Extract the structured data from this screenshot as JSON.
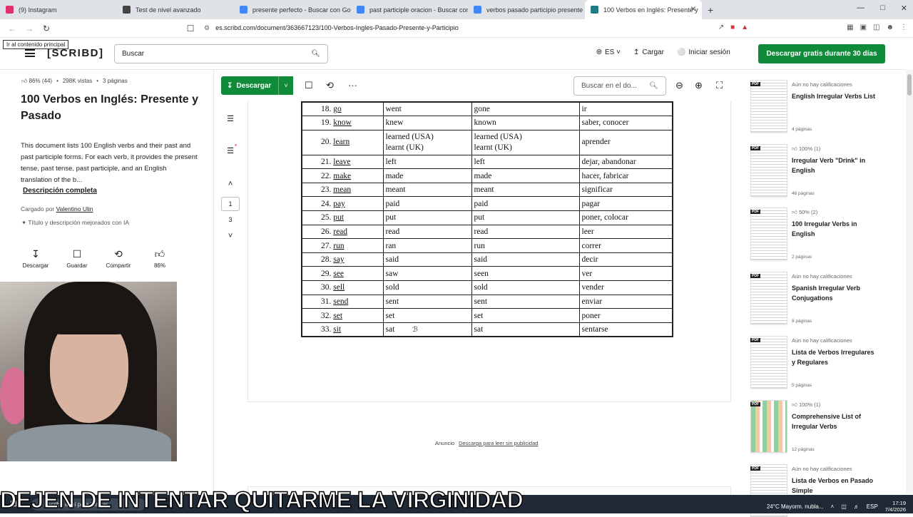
{
  "browser": {
    "tabs": [
      {
        "label": "(9) Instagram",
        "color": "#e1306c"
      },
      {
        "label": "Test de nivel avanzado",
        "color": "#444"
      },
      {
        "label": "presente perfecto - Buscar con Goog",
        "color": "#4285f4"
      },
      {
        "label": "past participle oracion - Buscar con G",
        "color": "#4285f4"
      },
      {
        "label": "verbos pasado participio presente q",
        "color": "#4285f4"
      },
      {
        "label": "100 Verbos en Inglés: Presente y",
        "color": "#1e7b85"
      }
    ],
    "url": "es.scribd.com/document/363667123/100-Verbos-Ingles-Pasado-Presente-y-Participio",
    "skip_link": "Ir al contenido principal"
  },
  "header": {
    "logo": "[SCRIBD]",
    "search_placeholder": "Buscar",
    "language": "ES",
    "upload": "Cargar",
    "login": "Iniciar sesión",
    "cta": "Descargar gratis durante 30 días"
  },
  "document": {
    "rating": "86% (44)",
    "views": "298K vistas",
    "pages_count": "3 páginas",
    "title": "100 Verbos en Inglés: Presente y Pasado",
    "description": "This document lists 100 English verbs and their past and past participle forms. For each verb, it provides the present tense, past tense, past participle, and an English translation of the b...",
    "full_description": "Descripción completa",
    "uploaded_by_label": "Cargado por",
    "uploader": "Valentino Ulin",
    "ai_note": "Título y descripción mejorados con IA",
    "actions": [
      {
        "label": "Descargar",
        "icon": "download-icon"
      },
      {
        "label": "Guardar",
        "icon": "bookmark-icon"
      },
      {
        "label": "Compartir",
        "icon": "share-icon"
      },
      {
        "label": "86%",
        "icon": "thumbs-up-icon"
      }
    ]
  },
  "toolbar": {
    "download": "Descargar",
    "doc_search_placeholder": "Buscar en el do..."
  },
  "pager": {
    "current": "1",
    "total": "3"
  },
  "verbs": [
    {
      "num": "18.",
      "base": "go",
      "past": "went",
      "participle": "gone",
      "spanish": "ir"
    },
    {
      "num": "19.",
      "base": "know",
      "past": "knew",
      "participle": "known",
      "spanish": "saber, conocer"
    },
    {
      "num": "20.",
      "base": "learn",
      "past": "learned (USA) learnt (UK)",
      "participle": "learned (USA) learnt (UK)",
      "spanish": "aprender"
    },
    {
      "num": "21.",
      "base": "leave",
      "past": "left",
      "participle": "left",
      "spanish": "dejar, abandonar"
    },
    {
      "num": "22.",
      "base": "make",
      "past": "made",
      "participle": "made",
      "spanish": "hacer, fabricar"
    },
    {
      "num": "23.",
      "base": "mean",
      "past": "meant",
      "participle": "meant",
      "spanish": "significar"
    },
    {
      "num": "24.",
      "base": "pay",
      "past": "paid",
      "participle": "paid",
      "spanish": "pagar"
    },
    {
      "num": "25.",
      "base": "put",
      "past": "put",
      "participle": "put",
      "spanish": "poner, colocar"
    },
    {
      "num": "26.",
      "base": "read",
      "past": "read",
      "participle": "read",
      "spanish": "leer"
    },
    {
      "num": "27.",
      "base": "run",
      "past": "ran",
      "participle": "run",
      "spanish": "correr"
    },
    {
      "num": "28.",
      "base": "say",
      "past": "said",
      "participle": "said",
      "spanish": "decir"
    },
    {
      "num": "29.",
      "base": "see",
      "past": "saw",
      "participle": "seen",
      "spanish": "ver"
    },
    {
      "num": "30.",
      "base": "sell",
      "past": "sold",
      "participle": "sold",
      "spanish": "vender"
    },
    {
      "num": "31.",
      "base": "send",
      "past": "sent",
      "participle": "sent",
      "spanish": "enviar"
    },
    {
      "num": "32.",
      "base": "set",
      "past": "set",
      "participle": "set",
      "spanish": "poner"
    },
    {
      "num": "33.",
      "base": "sit",
      "past": "sat",
      "participle": "sat",
      "spanish": "sentarse"
    }
  ],
  "ad": {
    "label": "Anuncio",
    "link": "Descarga para leer sin publicidad"
  },
  "recommendations": [
    {
      "rating": "Aún no hay calificaciones",
      "title": "English Irregular Verbs List",
      "pages": "4 páginas"
    },
    {
      "rating": "100% (1)",
      "title": "Irregular Verb \"Drink\" in English",
      "pages": "46 páginas"
    },
    {
      "rating": "50% (2)",
      "title": "100 Irregular Verbs in English",
      "pages": "2 páginas"
    },
    {
      "rating": "Aún no hay calificaciones",
      "title": "Spanish Irregular Verb Conjugations",
      "pages": "8 páginas"
    },
    {
      "rating": "Aún no hay calificaciones",
      "title": "Lista de Verbos Irregulares y Regulares",
      "pages": "5 páginas"
    },
    {
      "rating": "100% (1)",
      "title": "Comprehensive List of Irregular Verbs",
      "pages": "12 páginas"
    },
    {
      "rating": "Aún no hay calificaciones",
      "title": "Lista de Verbos en Pasado Simple",
      "pages": ""
    }
  ],
  "caption": "DEJEN DE INTENTAR QUITARME LA VIRGINIDAD",
  "taskbar": {
    "search_placeholder": "Escribe aquí para buscar",
    "weather": "24°C Mayorm. nubla...",
    "lang": "ESP",
    "time": "17:19",
    "date": "7/4/2026"
  }
}
